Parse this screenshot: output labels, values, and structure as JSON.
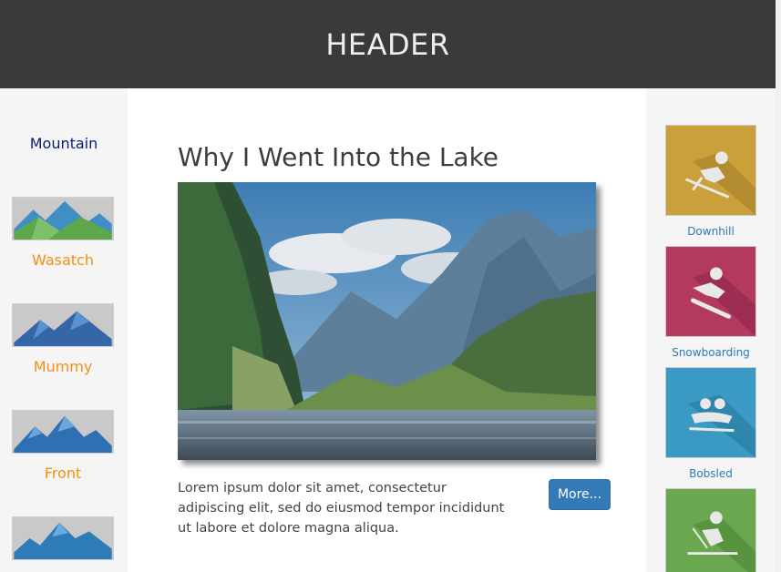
{
  "header": {
    "title": "HEADER"
  },
  "left_sidebar": {
    "title": "Mountain",
    "items": [
      {
        "label": "Wasatch"
      },
      {
        "label": "Mummy"
      },
      {
        "label": "Front"
      },
      {
        "label": ""
      }
    ]
  },
  "article": {
    "title": "Why I Went Into the Lake",
    "body": "Lorem ipsum dolor sit amet, consectetur adipiscing elit, sed do eiusmod tempor incididunt ut labore et dolore magna aliqua.",
    "more_label": "More..."
  },
  "right_sidebar": {
    "items": [
      {
        "label": "Downhill",
        "color": "#c9a03a"
      },
      {
        "label": "Snowboarding",
        "color": "#b3395f"
      },
      {
        "label": "Bobsled",
        "color": "#3a9ac4"
      },
      {
        "label": "",
        "color": "#6aa84f"
      }
    ]
  },
  "colors": {
    "header_bg": "#3a3a3a",
    "sidebar_bg": "#f5f5f5",
    "mountain_title": "#0b1a78",
    "mountain_label": "#f29111",
    "sport_label": "#2d7ab5",
    "button_bg": "#337ab7"
  }
}
